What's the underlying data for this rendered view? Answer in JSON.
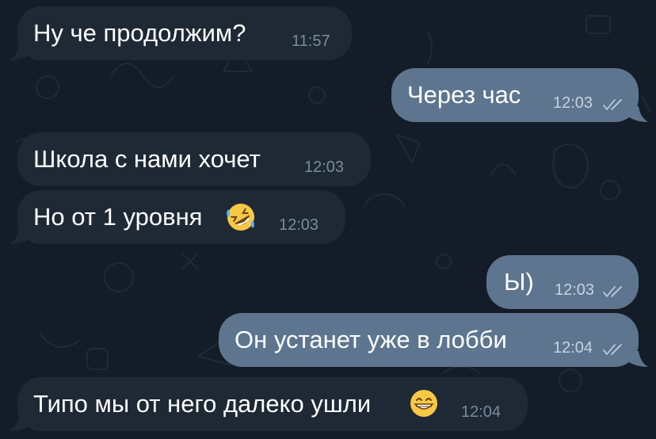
{
  "colors": {
    "background": "#141d27",
    "incoming_bubble": "#1f2936",
    "outgoing_bubble": "#5d758f",
    "text": "#ffffff",
    "incoming_time": "#7b8a99",
    "outgoing_time": "#c6d3e0"
  },
  "messages": [
    {
      "direction": "incoming",
      "text": "Ну че продолжим?",
      "time": "11:57"
    },
    {
      "direction": "outgoing",
      "text": "Через час",
      "time": "12:03",
      "status": "read"
    },
    {
      "direction": "incoming",
      "text": "Школа с нами хочет",
      "time": "12:03"
    },
    {
      "direction": "incoming",
      "text": "Но от 1 уровня",
      "emoji": "rolling-on-floor-laughing-emoji",
      "time": "12:03"
    },
    {
      "direction": "outgoing",
      "text": "Ы)",
      "time": "12:03",
      "status": "read"
    },
    {
      "direction": "outgoing",
      "text": "Он устанет уже в лобби",
      "time": "12:04",
      "status": "read"
    },
    {
      "direction": "incoming",
      "text": "Типо мы от него далеко ушли",
      "emoji": "grinning-face-emoji",
      "time": "12:04"
    }
  ]
}
